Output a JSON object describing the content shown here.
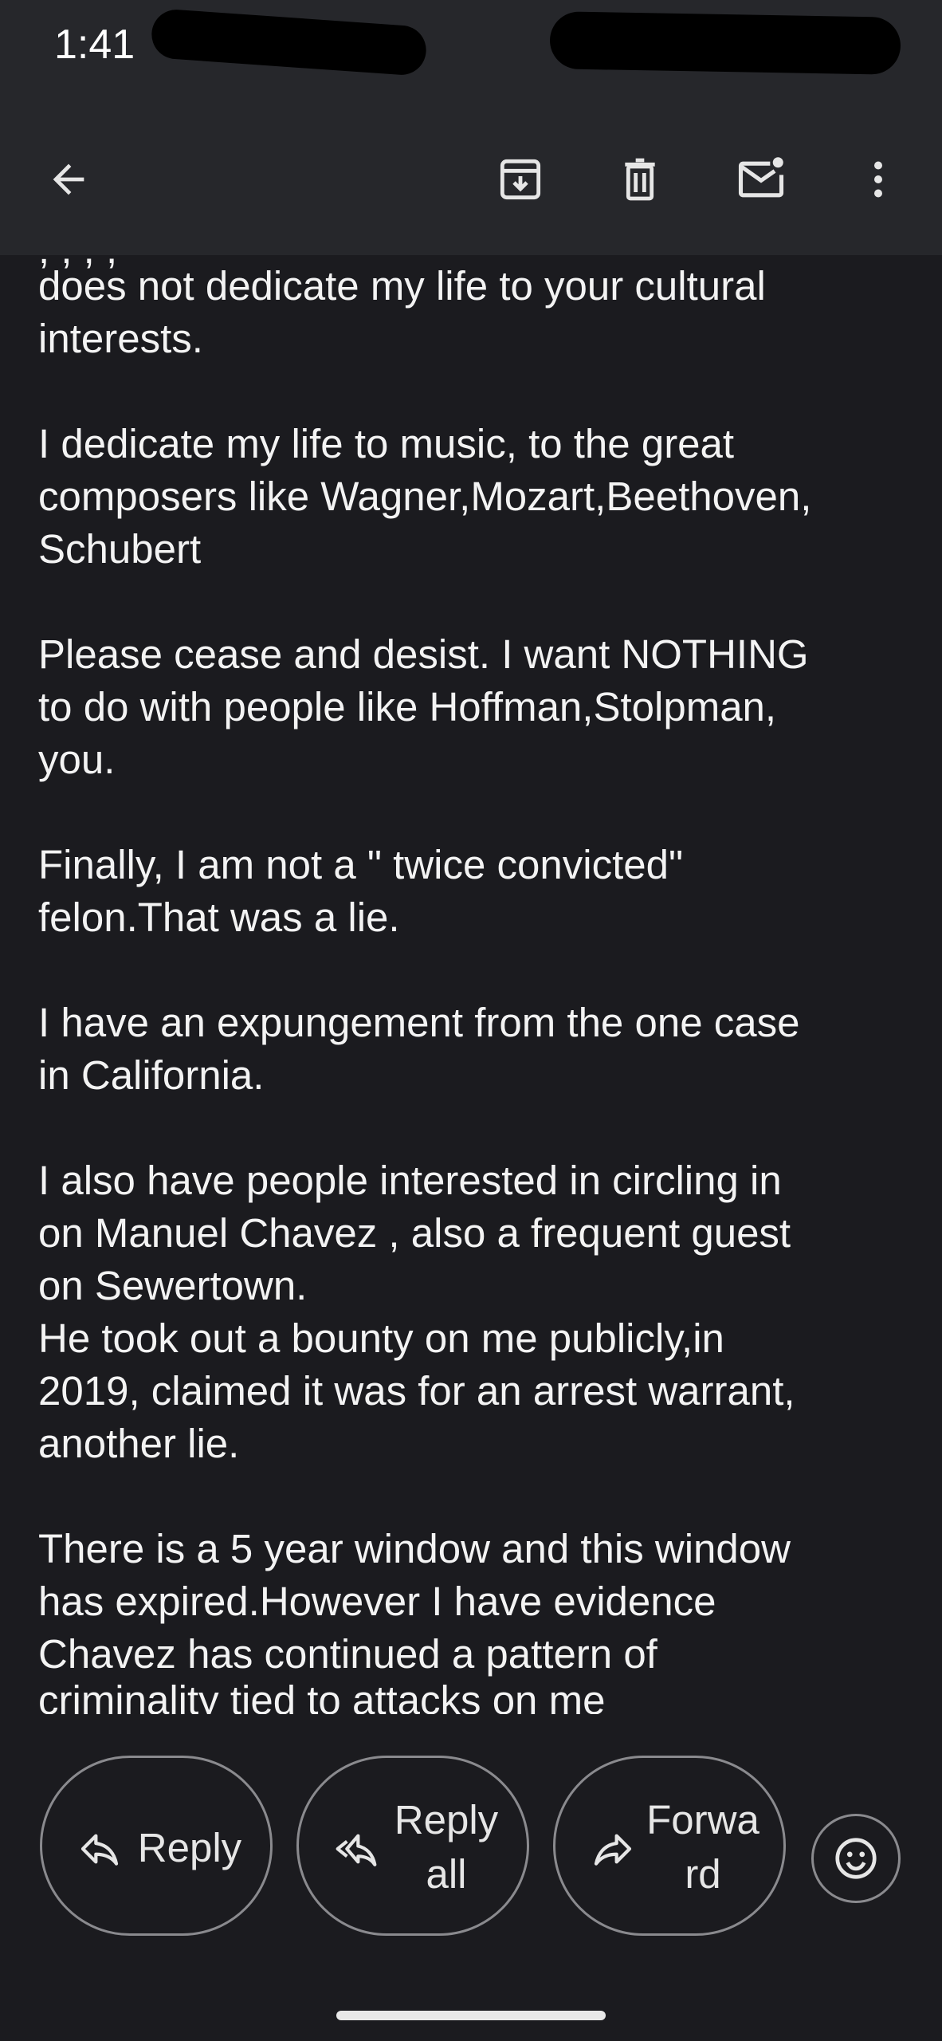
{
  "status_bar": {
    "time": "1:41"
  },
  "toolbar": {
    "back": "back-arrow-icon",
    "archive": "archive-icon",
    "delete": "trash-icon",
    "mark_unread": "mark-unread-icon",
    "more": "more-vert-icon"
  },
  "email": {
    "top_cut_line": "; ,   ,  ,",
    "paragraphs": [
      [
        "does not dedicate my life to your cultural",
        "interests."
      ],
      [
        "I dedicate my life to music, to the great",
        "composers like Wagner,Mozart,Beethoven,",
        "Schubert"
      ],
      [
        "Please cease and desist. I want NOTHING",
        "to do with people like Hoffman,Stolpman,",
        "you."
      ],
      [
        "Finally, I am not a \" twice convicted\"",
        "felon.That was a lie."
      ],
      [
        "I have an expungement from the one case",
        "in California."
      ],
      [
        "I also have people interested in circling in",
        "on Manuel Chavez , also a frequent guest",
        "on Sewertown.",
        "He took out a bounty on me publicly,in",
        "2019, claimed it was for an arrest warrant,",
        "another lie."
      ],
      [
        "There is a 5 year window and this window",
        "has expired.However I have evidence",
        "Chavez has continued a pattern of"
      ]
    ],
    "bottom_cut_line": "criminality tied to attacks on me"
  },
  "actions": {
    "reply_line1": "Reply",
    "reply_all_line1": "Reply",
    "reply_all_line2": "all",
    "forward_line1": "Forwa",
    "forward_line2": "rd",
    "emoji": "emoji-reaction-icon"
  },
  "colors": {
    "background": "#1b1b1f",
    "toolbar": "#26272b",
    "text": "#f3f3f3",
    "outline": "#8a8a8e"
  }
}
